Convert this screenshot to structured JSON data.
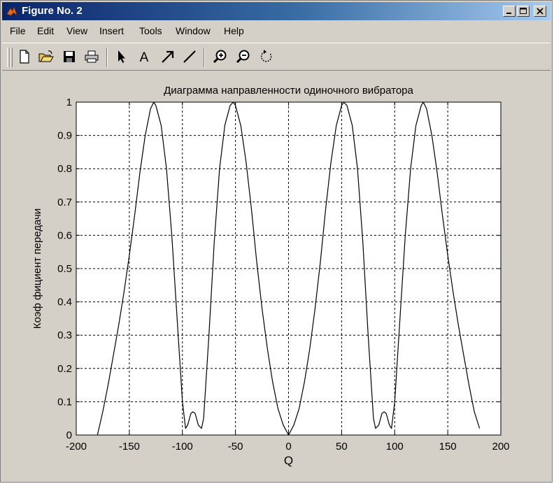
{
  "window": {
    "title": "Figure No. 2",
    "controls": {
      "minimize": "minimize",
      "maximize": "maximize",
      "close": "close"
    }
  },
  "menu": [
    "File",
    "Edit",
    "View",
    "Insert",
    "Tools",
    "Window",
    "Help"
  ],
  "toolbar": {
    "tools": [
      "new-figure-icon",
      "open-file-icon",
      "save-icon",
      "print-icon",
      "edit-plot-arrow-icon",
      "insert-text-icon",
      "insert-arrow-icon",
      "insert-line-icon",
      "zoom-in-icon",
      "zoom-out-icon",
      "rotate-3d-icon"
    ],
    "text_tool_label": "A"
  },
  "chart_data": {
    "type": "line",
    "title": "Диаграмма направленности одиночного вибратора",
    "xlabel": "Q",
    "ylabel": "Коэф фициент передачи",
    "xlim": [
      -200,
      200
    ],
    "ylim": [
      0,
      1
    ],
    "xticks": [
      "-200",
      "-150",
      "-100",
      "-50",
      "0",
      "50",
      "100",
      "150",
      "200"
    ],
    "yticks": [
      "0",
      "0.1",
      "0.2",
      "0.3",
      "0.4",
      "0.5",
      "0.6",
      "0.7",
      "0.8",
      "0.9",
      "1"
    ],
    "grid": true,
    "series": [
      {
        "color": "#000000",
        "x": [
          -180,
          -175,
          -170,
          -165,
          -160,
          -155,
          -150,
          -145,
          -140,
          -135,
          -130,
          -127,
          -125,
          -120,
          -115,
          -110,
          -105,
          -100,
          -97,
          -95,
          -92,
          -90,
          -88,
          -85,
          -82,
          -80,
          -75,
          -70,
          -65,
          -60,
          -55,
          -52,
          -50,
          -45,
          -40,
          -35,
          -30,
          -25,
          -20,
          -15,
          -10,
          -5,
          0,
          5,
          10,
          15,
          20,
          25,
          30,
          35,
          40,
          45,
          50,
          52,
          55,
          60,
          65,
          70,
          75,
          80,
          82,
          85,
          88,
          90,
          92,
          95,
          97,
          100,
          105,
          110,
          115,
          120,
          125,
          127,
          130,
          135,
          140,
          145,
          150,
          155,
          160,
          165,
          170,
          175,
          180
        ],
        "y": [
          0.0,
          0.07,
          0.15,
          0.24,
          0.33,
          0.43,
          0.54,
          0.66,
          0.79,
          0.9,
          0.98,
          1.0,
          0.99,
          0.93,
          0.8,
          0.6,
          0.35,
          0.1,
          0.02,
          0.03,
          0.065,
          0.07,
          0.065,
          0.03,
          0.02,
          0.05,
          0.3,
          0.58,
          0.8,
          0.93,
          0.99,
          1.0,
          0.99,
          0.93,
          0.82,
          0.68,
          0.52,
          0.38,
          0.26,
          0.16,
          0.08,
          0.03,
          0.0,
          0.03,
          0.08,
          0.16,
          0.26,
          0.38,
          0.52,
          0.68,
          0.82,
          0.93,
          0.99,
          1.0,
          0.99,
          0.93,
          0.8,
          0.58,
          0.3,
          0.05,
          0.02,
          0.03,
          0.065,
          0.07,
          0.065,
          0.03,
          0.02,
          0.1,
          0.35,
          0.6,
          0.8,
          0.93,
          0.99,
          1.0,
          0.98,
          0.9,
          0.79,
          0.66,
          0.54,
          0.43,
          0.33,
          0.24,
          0.15,
          0.07,
          0.02
        ]
      }
    ]
  }
}
